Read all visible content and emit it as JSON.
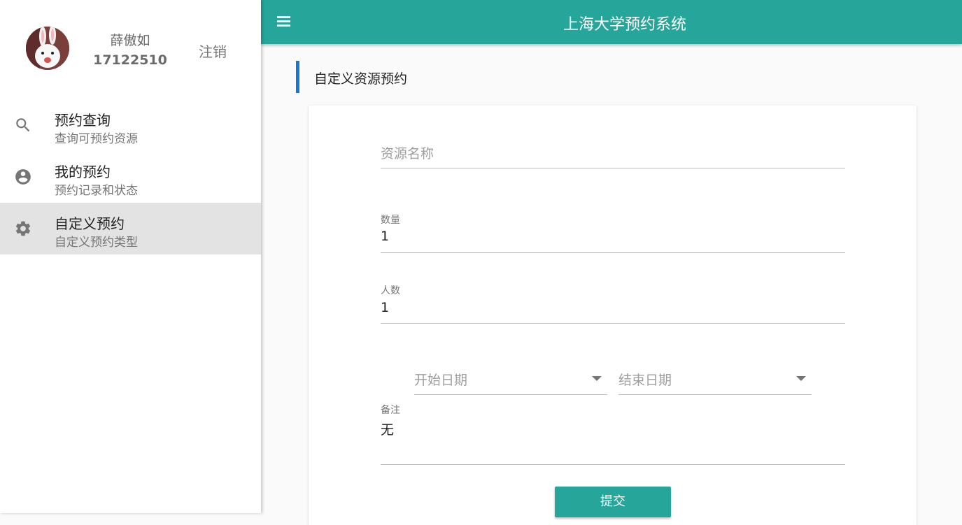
{
  "app": {
    "title": "上海大学预约系统"
  },
  "user": {
    "name": "薛傲如",
    "id": "17122510",
    "logout_label": "注销"
  },
  "nav": {
    "items": [
      {
        "title": "预约查询",
        "subtitle": "查询可预约资源",
        "icon": "search-icon"
      },
      {
        "title": "我的预约",
        "subtitle": "预约记录和状态",
        "icon": "account-circle-icon"
      },
      {
        "title": "自定义预约",
        "subtitle": "自定义预约类型",
        "icon": "gear-icon",
        "active": true
      }
    ]
  },
  "page": {
    "section_title": "自定义资源预约"
  },
  "form": {
    "resource_name": {
      "placeholder": "资源名称",
      "value": ""
    },
    "quantity": {
      "label": "数量",
      "value": "1"
    },
    "people": {
      "label": "人数",
      "value": "1"
    },
    "start_date": {
      "placeholder": "开始日期"
    },
    "end_date": {
      "placeholder": "结束日期"
    },
    "remark": {
      "label": "备注",
      "value": "无"
    },
    "submit_label": "提交"
  },
  "colors": {
    "primary": "#26a69a",
    "accent": "#1976d2",
    "active_nav": "#e3e3e3"
  }
}
